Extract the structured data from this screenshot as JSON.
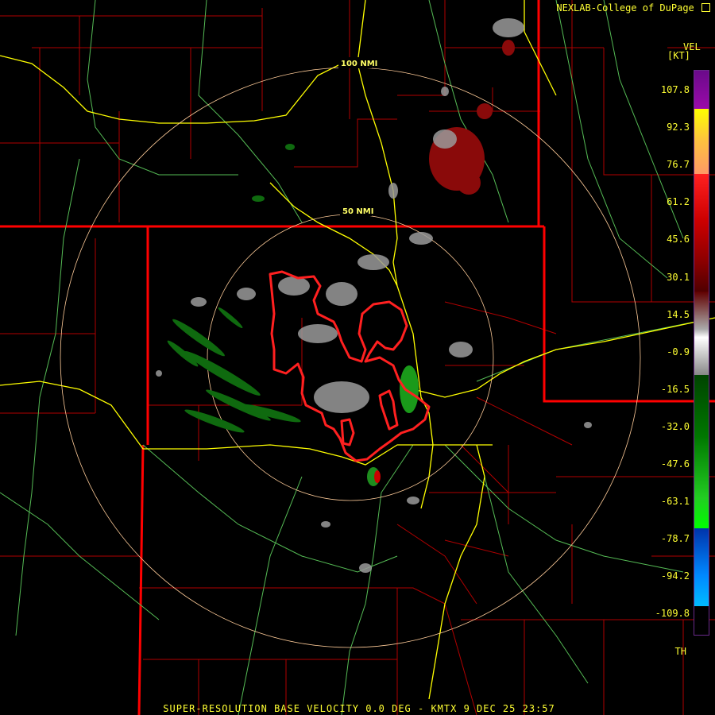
{
  "credit": "NEXLAB-College of DuPage",
  "credit_icon": "nexlab-logo-icon",
  "legend": {
    "product_code": "VEL",
    "unit": "[KT]",
    "tick_labels": [
      "107.8",
      "92.3",
      "76.7",
      "61.2",
      "45.6",
      "30.1",
      "14.5",
      "-0.9",
      "-16.5",
      "-32.0",
      "-47.6",
      "-63.1",
      "-78.7",
      "-94.2",
      "-109.8",
      "TH"
    ],
    "tick_values": [
      107.8,
      92.3,
      76.7,
      61.2,
      45.6,
      30.1,
      14.5,
      -0.9,
      -16.5,
      -32.0,
      -47.6,
      -63.1,
      -78.7,
      -94.2,
      -109.8
    ],
    "scale_colors": [
      "#6a0a8a",
      "#ffff00",
      "#ff9966",
      "#ff0000",
      "#8a0000",
      "#aaaaaa",
      "#006600",
      "#00ff00",
      "#0044ff",
      "#00bbff",
      "#000000"
    ]
  },
  "rings": {
    "inner_label": "50 NMI",
    "outer_label": "100 NMI"
  },
  "map_colors": {
    "state_border": "#ff0000",
    "county_border": "#bb0000",
    "highway": "#ffff00",
    "secondary_road": "#66cc66",
    "range_ring": "#ffcc99",
    "warning_polygon": "#ff2020"
  },
  "product_line": "SUPER-RESOLUTION BASE VELOCITY 0.0 DEG - KMTX 9 DEC 25 23:57"
}
